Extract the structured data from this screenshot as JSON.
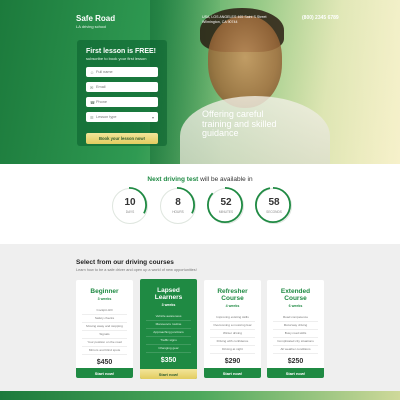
{
  "header": {
    "logo_title": "Safe Road",
    "logo_sub": "LA driving school",
    "address": "USA, LOS ANGELES 465 Saint S Street Wilmington, CA 90744",
    "phone": "(800) 2345 6789"
  },
  "form": {
    "title": "First lesson is FREE!",
    "subtitle": "subscribe to book your first lesson",
    "fields": [
      {
        "icon": "user-icon",
        "placeholder": "Full name"
      },
      {
        "icon": "mail-icon",
        "placeholder": "Email"
      },
      {
        "icon": "phone-icon",
        "placeholder": "Phone"
      },
      {
        "icon": "list-icon",
        "placeholder": "Lesson type"
      }
    ],
    "button": "Book your lesson now!"
  },
  "hero": {
    "tagline": "Offering careful training and skilled guidance"
  },
  "timer": {
    "title_accent": "Next driving test",
    "title_rest": " will be available in",
    "items": [
      {
        "value": "10",
        "label": "DAYS",
        "fraction": 0.33
      },
      {
        "value": "8",
        "label": "HOURS",
        "fraction": 0.33
      },
      {
        "value": "52",
        "label": "MINUTES",
        "fraction": 0.87
      },
      {
        "value": "58",
        "label": "SECONDS",
        "fraction": 0.97
      }
    ]
  },
  "courses": {
    "title": "Select from our driving courses",
    "subtitle": "Learn how to be a safe driver and open up a world of new opportunities!",
    "cards": [
      {
        "title": "Beginner",
        "weeks": "3 weeks",
        "features": [
          "Cockpit drill",
          "Safety checks",
          "Moving away and stopping",
          "Signals",
          "Your position on the road",
          "Mirrors and blind spots"
        ],
        "price": "$450",
        "button": "Start now!"
      },
      {
        "title": "Lapsed Learners",
        "weeks": "3 weeks",
        "features": [
          "Vehicle awareness",
          "Manoeuvre routine",
          "Approaching junctions",
          "Traffic signs",
          "Changing gear"
        ],
        "price": "$350",
        "button": "Start now!"
      },
      {
        "title": "Refresher Course",
        "weeks": "4 weeks",
        "features": [
          "Improving existing skills",
          "Overcoming a motoring fear",
          "Winter driving",
          "Driving with confidence",
          "Driving at night"
        ],
        "price": "$290",
        "button": "Start now!"
      },
      {
        "title": "Extended Course",
        "weeks": "6 weeks",
        "features": [
          "Road competence",
          "Motorway driving",
          "Busy road skills",
          "Complicated city situations",
          "All weather conditions"
        ],
        "price": "$250",
        "button": "Start now!"
      }
    ]
  },
  "colors": {
    "brand_green": "#1f8a43",
    "accent_yellow": "#e2cc5f"
  }
}
